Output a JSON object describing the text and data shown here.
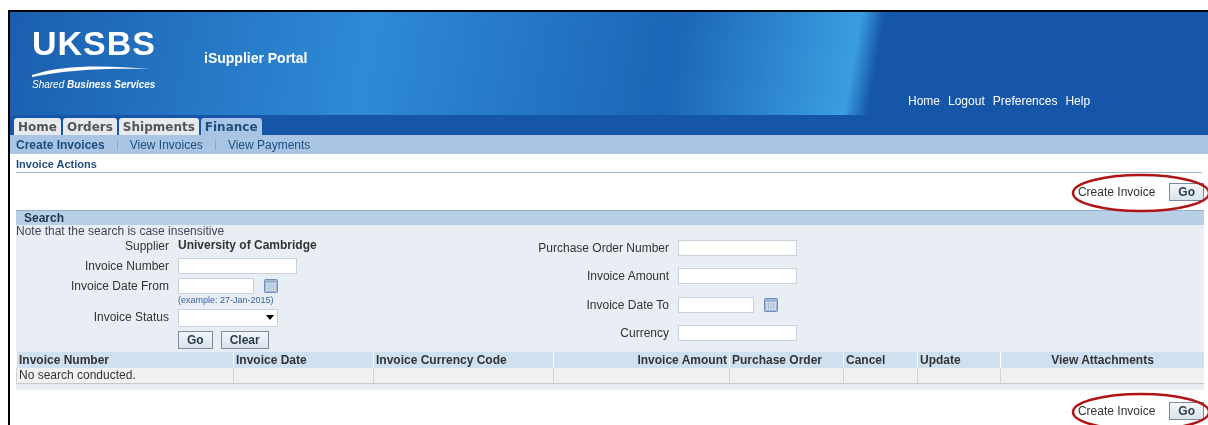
{
  "header": {
    "logo": "UKSBS",
    "logo_tagline_light": "Shared",
    "logo_tagline_bold": "Business Services",
    "app_title": "iSupplier Portal",
    "global_links": [
      "Home",
      "Logout",
      "Preferences",
      "Help"
    ]
  },
  "tabs": [
    {
      "label": "Home",
      "selected": false
    },
    {
      "label": "Orders",
      "selected": false
    },
    {
      "label": "Shipments",
      "selected": false
    },
    {
      "label": "Finance",
      "selected": true
    }
  ],
  "subtabs": [
    {
      "label": "Create Invoices",
      "selected": true
    },
    {
      "label": "View Invoices",
      "selected": false
    },
    {
      "label": "View Payments",
      "selected": false
    }
  ],
  "section_title": "Invoice Actions",
  "top_action": {
    "choice": "Create Invoice",
    "button": "Go",
    "highlighted": true
  },
  "search": {
    "title": "Search",
    "note": "Note that the search is case insensitive",
    "left_fields": [
      {
        "kind": "static",
        "label": "Supplier",
        "value": "University of Cambridge"
      },
      {
        "kind": "text",
        "label": "Invoice Number"
      },
      {
        "kind": "date",
        "label": "Invoice Date From",
        "hint": "(example: 27-Jan-2015)"
      },
      {
        "kind": "select",
        "label": "Invoice Status"
      }
    ],
    "right_fields": [
      {
        "kind": "text",
        "label": "Purchase Order Number"
      },
      {
        "kind": "text",
        "label": "Invoice Amount"
      },
      {
        "kind": "date",
        "label": "Invoice Date To"
      },
      {
        "kind": "text",
        "label": "Currency"
      }
    ],
    "buttons": [
      "Go",
      "Clear"
    ]
  },
  "table": {
    "columns": [
      "Invoice Number",
      "Invoice Date",
      "Invoice Currency Code",
      "Invoice Amount",
      "Purchase Order",
      "Cancel",
      "Update",
      "View Attachments"
    ],
    "empty_message": "No search conducted."
  },
  "bottom_action": {
    "choice": "Create Invoice",
    "button": "Go",
    "highlighted": true
  }
}
